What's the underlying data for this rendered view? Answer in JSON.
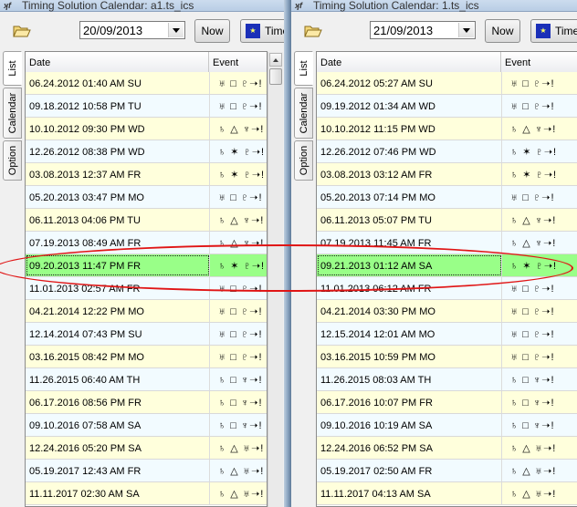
{
  "left_window": {
    "title": "Timing Solution Calendar: a1.ts_ics",
    "date_value": "20/09/2013",
    "now_label": "Now",
    "time_label": "Time",
    "tabs": [
      "List",
      "Calendar",
      "Option"
    ],
    "columns": {
      "date": "Date",
      "event": "Event"
    },
    "selected_row": 9,
    "rows": [
      {
        "date": "06.24.2012  01:40 AM SU",
        "event": "♅ □ ♇➝!"
      },
      {
        "date": "09.18.2012  10:58 PM TU",
        "event": "♅ □ ♇➝!"
      },
      {
        "date": "10.10.2012  09:30 PM WD",
        "event": "♄ △ ♆➝!"
      },
      {
        "date": "12.26.2012  08:38 PM WD",
        "event": "♄ ✶ ♇➝!"
      },
      {
        "date": "03.08.2013  12:37 AM FR",
        "event": "♄ ✶ ♇➝!"
      },
      {
        "date": "05.20.2013  03:47 PM MO",
        "event": "♅ □ ♇➝!"
      },
      {
        "date": "06.11.2013  04:06 PM TU",
        "event": "♄ △ ♆➝!"
      },
      {
        "date": "07.19.2013  08:49 AM FR",
        "event": "♄ △ ♆➝!"
      },
      {
        "date": "09.20.2013  11:47 PM FR",
        "event": "♄ ✶ ♇➝!"
      },
      {
        "date": "11.01.2013  02:57 AM FR",
        "event": "♅ □ ♇➝!"
      },
      {
        "date": "04.21.2014  12:22 PM MO",
        "event": "♅ □ ♇➝!"
      },
      {
        "date": "12.14.2014  07:43 PM SU",
        "event": "♅ □ ♇➝!"
      },
      {
        "date": "03.16.2015  08:42 PM MO",
        "event": "♅ □ ♇➝!"
      },
      {
        "date": "11.26.2015  06:40 AM TH",
        "event": "♄ □ ♆➝!"
      },
      {
        "date": "06.17.2016  08:56 PM FR",
        "event": "♄ □ ♆➝!"
      },
      {
        "date": "09.10.2016  07:58 AM SA",
        "event": "♄ □ ♆➝!"
      },
      {
        "date": "12.24.2016  05:20 PM SA",
        "event": "♄ △ ♅➝!"
      },
      {
        "date": "05.19.2017  12:43 AM FR",
        "event": "♄ △ ♅➝!"
      },
      {
        "date": "11.11.2017  02:30 AM SA",
        "event": "♄ △ ♅➝!"
      }
    ]
  },
  "right_window": {
    "title": "Timing Solution Calendar: 1.ts_ics",
    "date_value": "21/09/2013",
    "now_label": "Now",
    "time_label": "Time",
    "tabs": [
      "List",
      "Calendar",
      "Option"
    ],
    "columns": {
      "date": "Date",
      "event": "Event"
    },
    "selected_row": 9,
    "rows": [
      {
        "date": "06.24.2012  05:27 AM SU",
        "event": "♅ □ ♇➝!"
      },
      {
        "date": "09.19.2012  01:34 AM WD",
        "event": "♅ □ ♇➝!"
      },
      {
        "date": "10.10.2012  11:15 PM WD",
        "event": "♄ △ ♆➝!"
      },
      {
        "date": "12.26.2012  07:46 PM WD",
        "event": "♄ ✶ ♇➝!"
      },
      {
        "date": "03.08.2013  03:12 AM FR",
        "event": "♄ ✶ ♇➝!"
      },
      {
        "date": "05.20.2013  07:14 PM MO",
        "event": "♅ □ ♇➝!"
      },
      {
        "date": "06.11.2013  05:07 PM TU",
        "event": "♄ △ ♆➝!"
      },
      {
        "date": "07.19.2013  11:45 AM FR",
        "event": "♄ △ ♆➝!"
      },
      {
        "date": "09.21.2013  01:12 AM SA",
        "event": "♄ ✶ ♇➝!"
      },
      {
        "date": "11.01.2013  06:12 AM FR",
        "event": "♅ □ ♇➝!"
      },
      {
        "date": "04.21.2014  03:30 PM MO",
        "event": "♅ □ ♇➝!"
      },
      {
        "date": "12.15.2014  12:01 AM MO",
        "event": "♅ □ ♇➝!"
      },
      {
        "date": "03.16.2015  10:59 PM MO",
        "event": "♅ □ ♇➝!"
      },
      {
        "date": "11.26.2015  08:03 AM TH",
        "event": "♄ □ ♆➝!"
      },
      {
        "date": "06.17.2016  10:07 PM FR",
        "event": "♄ □ ♆➝!"
      },
      {
        "date": "09.10.2016  10:19 AM SA",
        "event": "♄ □ ♆➝!"
      },
      {
        "date": "12.24.2016  06:52 PM SA",
        "event": "♄ △ ♅➝!"
      },
      {
        "date": "05.19.2017  02:50 AM FR",
        "event": "♄ △ ♅➝!"
      },
      {
        "date": "11.11.2017  04:13 AM SA",
        "event": "♄ △ ♅➝!"
      }
    ]
  },
  "colors": {
    "row_odd": "#ffffdc",
    "row_even": "#f2fbff",
    "row_selected": "#99ff88",
    "highlight_ellipse": "#e01515"
  },
  "icons": [
    "app-icon",
    "open-folder-icon",
    "combo-arrow-icon",
    "time-icon",
    "scroll-up-arrow-icon"
  ]
}
